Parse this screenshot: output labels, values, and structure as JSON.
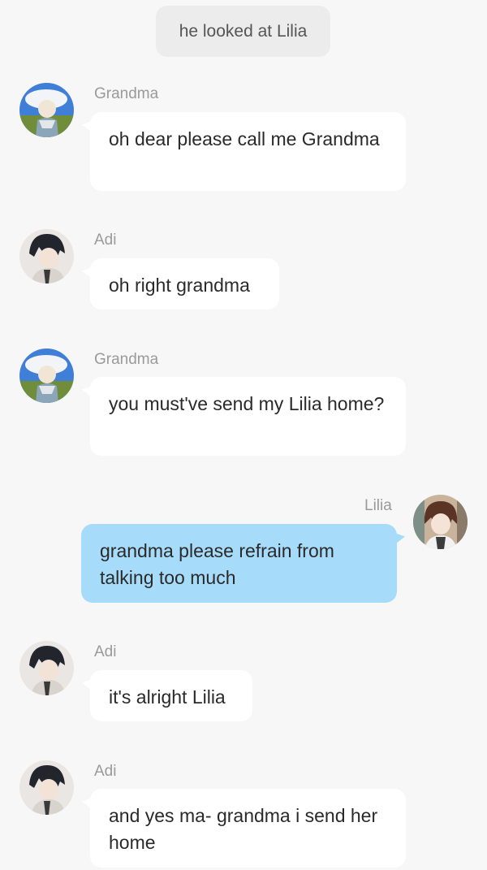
{
  "system_note": "he looked at Lilia",
  "messages": [
    {
      "sender": "Grandma",
      "avatar": "grandma-avatar",
      "side": "left",
      "text": "oh dear please call me Grandma"
    },
    {
      "sender": "Adi",
      "avatar": "adi-avatar",
      "side": "left",
      "text": "oh right grandma"
    },
    {
      "sender": "Grandma",
      "avatar": "grandma-avatar",
      "side": "left",
      "text": "you must've send my Lilia home?"
    },
    {
      "sender": "Lilia",
      "avatar": "lilia-avatar",
      "side": "right",
      "text": "grandma please refrain from talking too much"
    },
    {
      "sender": "Adi",
      "avatar": "adi-avatar",
      "side": "left",
      "text": "it's alright Lilia"
    },
    {
      "sender": "Adi",
      "avatar": "adi-avatar",
      "side": "left",
      "text": "and yes ma- grandma i send her home"
    }
  ],
  "colors": {
    "background": "#f7f7f7",
    "incoming_bubble": "#ffffff",
    "outgoing_bubble": "#a6dcfa",
    "system_note_bg": "#ececec",
    "sender_name": "#9a9a9a"
  }
}
